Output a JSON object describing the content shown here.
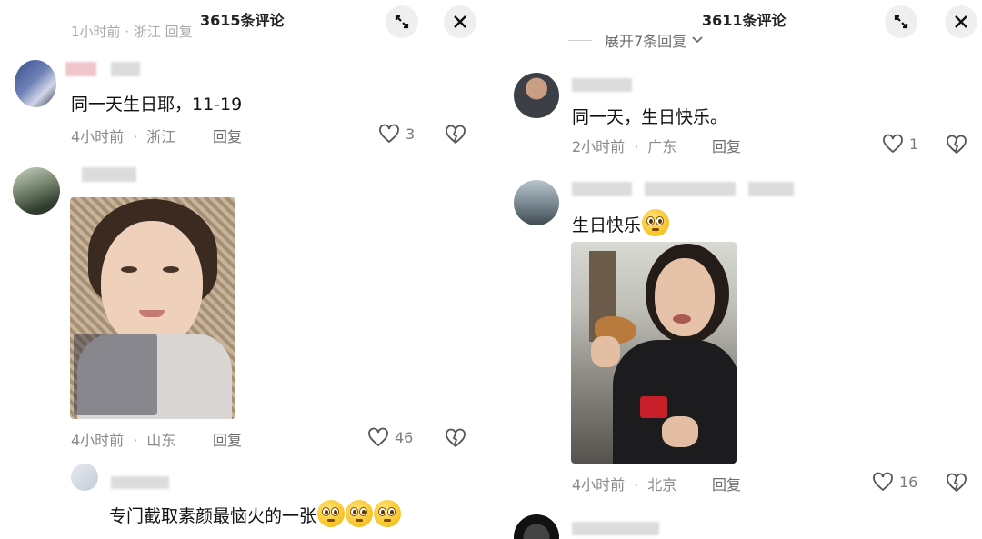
{
  "left": {
    "title": "3615条评论",
    "top_partial_meta": "1小时前 · 浙江  回复",
    "comment1": {
      "text": "同一天生日耶，11-19",
      "time": "4小时前",
      "location": "浙江",
      "reply": "回复",
      "likes": "3"
    },
    "comment2": {
      "time": "4小时前",
      "location": "山东",
      "reply": "回复",
      "likes": "46"
    },
    "comment3": {
      "text": "专门截取素颜最恼火的一张"
    },
    "icons": {
      "collapse": "collapse-icon",
      "close": "close-icon"
    }
  },
  "right": {
    "title": "3611条评论",
    "expand_replies": "展开7条回复",
    "comment1": {
      "text": "同一天，生日快乐。",
      "time": "2小时前",
      "location": "广东",
      "reply": "回复",
      "likes": "1"
    },
    "comment2": {
      "text": "生日快乐",
      "time": "4小时前",
      "location": "北京",
      "reply": "回复",
      "likes": "16"
    },
    "icons": {
      "collapse": "collapse-icon",
      "close": "close-icon"
    }
  },
  "colors": {
    "meta_gray": "#8a8a8a",
    "text": "#111111",
    "button_bg": "#efefef",
    "emoji_yellow": "#f4b400"
  }
}
